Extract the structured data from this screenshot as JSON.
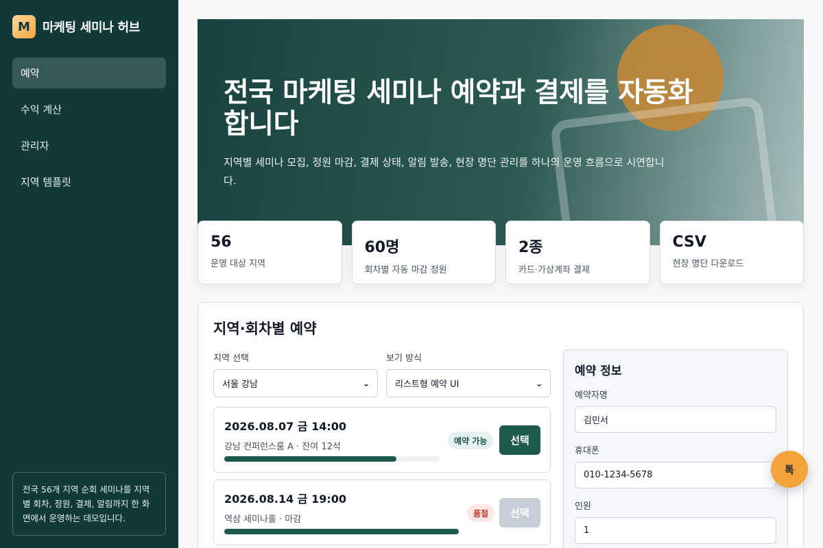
{
  "brand": {
    "logo": "M",
    "name": "마케팅 세미나 허브"
  },
  "nav": [
    {
      "label": "예약",
      "active": true
    },
    {
      "label": "수익 계산",
      "active": false
    },
    {
      "label": "관리자",
      "active": false
    },
    {
      "label": "지역 템플릿",
      "active": false
    }
  ],
  "side_note": "전국 56개 지역 순회 세미나를 지역별 회차, 정원, 결제, 알림까지 한 화면에서 운영하는 데모입니다.",
  "hero": {
    "title": "전국 마케팅 세미나 예약과 결제를 자동화합니다",
    "subtitle": "지역별 세미나 모집, 정원 마감, 결제 상태, 알림 발송, 현장 명단 관리를 하나의 운영 흐름으로 시연합니다."
  },
  "stats": [
    {
      "value": "56",
      "label": "운영 대상 지역"
    },
    {
      "value": "60명",
      "label": "회차별 자동 마감 정원"
    },
    {
      "value": "2종",
      "label": "카드·가상계좌 결제"
    },
    {
      "value": "CSV",
      "label": "현장 명단 다운로드"
    }
  ],
  "booking": {
    "title": "지역·회차별 예약",
    "region_label": "지역 선택",
    "region_value": "서울 강남",
    "view_label": "보기 방식",
    "view_value": "리스트형 예약 UI",
    "sessions": [
      {
        "date": "2026.08.07 금 14:00",
        "meta": "강남 컨퍼런스룸 A · 잔여 12석",
        "badge": "예약 가능",
        "status": "ok",
        "button": "선택",
        "fill": 0.8
      },
      {
        "date": "2026.08.14 금 19:00",
        "meta": "역삼 세미나홀 · 마감",
        "badge": "품절",
        "status": "full",
        "button": "선택",
        "fill": 1.0
      }
    ]
  },
  "form": {
    "title": "예약 정보",
    "name_label": "예약자명",
    "name_value": "김민서",
    "phone_label": "휴대폰",
    "phone_value": "010-1234-5678",
    "count_label": "인원",
    "count_value": "1"
  },
  "fab_label": "톡",
  "colors": {
    "sidebar": "#11393a",
    "accent": "#1d5a50",
    "fab": "#f2a33a"
  }
}
